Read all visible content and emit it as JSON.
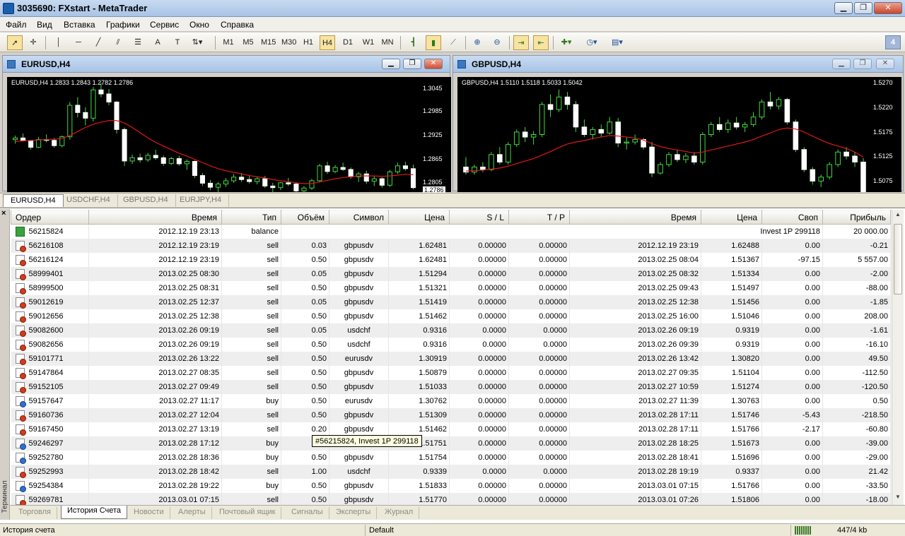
{
  "app": {
    "title": "3035690: FXstart - MetaTrader"
  },
  "window_buttons": {
    "minimize": "▁",
    "restore": "❐",
    "close": "✕"
  },
  "menu": [
    "Файл",
    "Вид",
    "Вставка",
    "Графики",
    "Сервис",
    "Окно",
    "Справка"
  ],
  "toolbar": {
    "tool_icons": [
      "cursor-icon",
      "crosshair-icon",
      "vertical-line-icon",
      "horizontal-line-icon",
      "trendline-icon",
      "equidistant-channel-icon",
      "fibonacci-icon",
      "text-icon",
      "text-label-icon",
      "arrows-icon"
    ],
    "timeframes": [
      "M1",
      "M5",
      "M15",
      "M30",
      "H1",
      "H4",
      "D1",
      "W1",
      "MN"
    ],
    "selected_timeframe": "H4",
    "pane_number": "4"
  },
  "charts": [
    {
      "title": "EURUSD,H4",
      "header": "EURUSD,H4  1.2833 1.2843 1.2782 1.2786",
      "prices": [
        "1.3045",
        "1.2985",
        "1.2925",
        "1.2865",
        "1.2805",
        "1.2786"
      ],
      "candles": [
        [
          1.2905,
          1.2915,
          1.2895,
          1.2909
        ],
        [
          1.2909,
          1.292,
          1.29,
          1.2902
        ],
        [
          1.2902,
          1.2904,
          1.288,
          1.2886
        ],
        [
          1.2886,
          1.2912,
          1.2884,
          1.2905
        ],
        [
          1.2905,
          1.2918,
          1.2898,
          1.2903
        ],
        [
          1.2903,
          1.2909,
          1.2885,
          1.289
        ],
        [
          1.289,
          1.2915,
          1.2886,
          1.2912
        ],
        [
          1.2912,
          1.2998,
          1.2905,
          1.299
        ],
        [
          1.299,
          1.301,
          1.296,
          1.2972
        ],
        [
          1.2972,
          1.2985,
          1.294,
          1.2958
        ],
        [
          1.2958,
          1.3035,
          1.295,
          1.3028
        ],
        [
          1.3028,
          1.3045,
          1.301,
          1.3018
        ],
        [
          1.3018,
          1.303,
          1.299,
          1.2998
        ],
        [
          1.2998,
          1.3,
          1.292,
          1.293
        ],
        [
          1.293,
          1.2935,
          1.284,
          1.2852
        ],
        [
          1.2852,
          1.2868,
          1.2845,
          1.286
        ],
        [
          1.286,
          1.287,
          1.2848,
          1.2855
        ],
        [
          1.2855,
          1.2872,
          1.285,
          1.2866
        ],
        [
          1.2866,
          1.288,
          1.2855,
          1.286
        ],
        [
          1.286,
          1.2866,
          1.284,
          1.2846
        ],
        [
          1.2846,
          1.2862,
          1.2842,
          1.2858
        ],
        [
          1.2858,
          1.2865,
          1.284,
          1.2845
        ],
        [
          1.2845,
          1.2856,
          1.283,
          1.2851
        ],
        [
          1.2851,
          1.2853,
          1.281,
          1.2816
        ],
        [
          1.2816,
          1.2822,
          1.279,
          1.2797
        ],
        [
          1.2797,
          1.2805,
          1.278,
          1.2787
        ],
        [
          1.2787,
          1.28,
          1.2775,
          1.2795
        ],
        [
          1.2795,
          1.281,
          1.2788,
          1.2803
        ],
        [
          1.2803,
          1.282,
          1.2798,
          1.2812
        ],
        [
          1.2812,
          1.2822,
          1.28,
          1.2806
        ],
        [
          1.2806,
          1.2816,
          1.2796,
          1.2801
        ],
        [
          1.2801,
          1.2812,
          1.2794,
          1.2808
        ],
        [
          1.2808,
          1.2815,
          1.2785,
          1.279
        ],
        [
          1.279,
          1.2798,
          1.2775,
          1.2786
        ],
        [
          1.2786,
          1.28,
          1.278,
          1.2798
        ],
        [
          1.2798,
          1.281,
          1.279,
          1.2795
        ],
        [
          1.2795,
          1.28,
          1.277,
          1.2778
        ],
        [
          1.2778,
          1.279,
          1.2765,
          1.2785
        ],
        [
          1.2785,
          1.2808,
          1.278,
          1.2803
        ],
        [
          1.2803,
          1.2845,
          1.28,
          1.284
        ],
        [
          1.284,
          1.285,
          1.282,
          1.2826
        ],
        [
          1.2826,
          1.2842,
          1.2822,
          1.2836
        ],
        [
          1.2836,
          1.2848,
          1.2828,
          1.2831
        ],
        [
          1.2831,
          1.2836,
          1.2808,
          1.2813
        ],
        [
          1.2813,
          1.2825,
          1.28,
          1.282
        ],
        [
          1.282,
          1.2828,
          1.2795,
          1.2802
        ],
        [
          1.2802,
          1.2815,
          1.279,
          1.2808
        ],
        [
          1.2808,
          1.2812,
          1.2786,
          1.2792
        ],
        [
          1.2792,
          1.283,
          1.2788,
          1.2825
        ],
        [
          1.2825,
          1.2848,
          1.282,
          1.284
        ],
        [
          1.284,
          1.285,
          1.2828,
          1.2833
        ],
        [
          1.2833,
          1.2843,
          1.2782,
          1.2786
        ]
      ],
      "ma": [
        1.29,
        1.2902,
        1.2903,
        1.2904,
        1.2905,
        1.2906,
        1.2908,
        1.2915,
        1.2925,
        1.2935,
        1.2943,
        1.2948,
        1.2952,
        1.2952,
        1.2946,
        1.2935,
        1.2922,
        1.2909,
        1.2898,
        1.2889,
        1.288,
        1.2871,
        1.2864,
        1.2856,
        1.2848,
        1.284,
        1.2833,
        1.2828,
        1.2824,
        1.282,
        1.2816,
        1.2813,
        1.281,
        1.2806,
        1.2803,
        1.2801,
        1.2798,
        1.2796,
        1.2796,
        1.28,
        1.2804,
        1.2808,
        1.2811,
        1.2813,
        1.2815,
        1.2815,
        1.2815,
        1.2814,
        1.2815,
        1.2817,
        1.2819,
        1.2818
      ],
      "range": [
        1.2775,
        1.306
      ]
    },
    {
      "title": "GBPUSD,H4",
      "header": "GBPUSD,H4  1.5110 1.5118 1.5033 1.5042",
      "prices": [
        "1.5270",
        "1.5220",
        "1.5175",
        "1.5125",
        "1.5075"
      ],
      "candles": [
        [
          1.51,
          1.512,
          1.5085,
          1.509
        ],
        [
          1.509,
          1.5105,
          1.5085,
          1.51
        ],
        [
          1.51,
          1.511,
          1.509,
          1.5095
        ],
        [
          1.5095,
          1.513,
          1.5092,
          1.5125
        ],
        [
          1.5125,
          1.514,
          1.5105,
          1.511
        ],
        [
          1.511,
          1.515,
          1.5105,
          1.5145
        ],
        [
          1.5145,
          1.5175,
          1.514,
          1.517
        ],
        [
          1.517,
          1.518,
          1.515,
          1.516
        ],
        [
          1.516,
          1.5172,
          1.5145,
          1.5165
        ],
        [
          1.5165,
          1.523,
          1.516,
          1.5225
        ],
        [
          1.5225,
          1.5245,
          1.52,
          1.5215
        ],
        [
          1.5215,
          1.5255,
          1.521,
          1.524
        ],
        [
          1.524,
          1.525,
          1.5215,
          1.5225
        ],
        [
          1.5225,
          1.5232,
          1.517,
          1.518
        ],
        [
          1.518,
          1.5195,
          1.516,
          1.5165
        ],
        [
          1.5165,
          1.518,
          1.5155,
          1.5175
        ],
        [
          1.5175,
          1.5185,
          1.516,
          1.5168
        ],
        [
          1.5168,
          1.52,
          1.5165,
          1.519
        ],
        [
          1.519,
          1.5198,
          1.514,
          1.5148
        ],
        [
          1.5148,
          1.516,
          1.5135,
          1.515
        ],
        [
          1.515,
          1.5165,
          1.5145,
          1.5155
        ],
        [
          1.5155,
          1.5158,
          1.5135,
          1.514
        ],
        [
          1.514,
          1.515,
          1.508,
          1.5088
        ],
        [
          1.5088,
          1.511,
          1.5085,
          1.5105
        ],
        [
          1.5105,
          1.513,
          1.51,
          1.5125
        ],
        [
          1.5125,
          1.5135,
          1.511,
          1.5115
        ],
        [
          1.5115,
          1.5128,
          1.5108,
          1.5122
        ],
        [
          1.5122,
          1.513,
          1.5105,
          1.511
        ],
        [
          1.511,
          1.517,
          1.5105,
          1.5165
        ],
        [
          1.5165,
          1.519,
          1.516,
          1.5185
        ],
        [
          1.5185,
          1.52,
          1.517,
          1.5175
        ],
        [
          1.5175,
          1.5195,
          1.5168,
          1.5188
        ],
        [
          1.5188,
          1.52,
          1.5175,
          1.518
        ],
        [
          1.518,
          1.519,
          1.517,
          1.5185
        ],
        [
          1.5185,
          1.521,
          1.518,
          1.52
        ],
        [
          1.52,
          1.5235,
          1.5195,
          1.523
        ],
        [
          1.523,
          1.525,
          1.5215,
          1.5222
        ],
        [
          1.5222,
          1.524,
          1.5215,
          1.5235
        ],
        [
          1.5235,
          1.5238,
          1.5185,
          1.519
        ],
        [
          1.519,
          1.5195,
          1.513,
          1.5135
        ],
        [
          1.5135,
          1.514,
          1.509,
          1.5095
        ],
        [
          1.5095,
          1.51,
          1.5065,
          1.5072
        ],
        [
          1.5072,
          1.5085,
          1.506,
          1.508
        ],
        [
          1.508,
          1.511,
          1.5075,
          1.5105
        ],
        [
          1.5105,
          1.5135,
          1.51,
          1.513
        ],
        [
          1.513,
          1.514,
          1.5115,
          1.5122
        ],
        [
          1.5122,
          1.513,
          1.51,
          1.511
        ],
        [
          1.511,
          1.5118,
          1.5033,
          1.5042
        ]
      ],
      "ma": [
        1.5092,
        1.5093,
        1.5094,
        1.5096,
        1.5098,
        1.5102,
        1.5107,
        1.5112,
        1.5117,
        1.5124,
        1.5131,
        1.5139,
        1.5146,
        1.515,
        1.5153,
        1.5157,
        1.516,
        1.5163,
        1.5162,
        1.516,
        1.5158,
        1.5154,
        1.5147,
        1.5141,
        1.5137,
        1.5134,
        1.5131,
        1.5128,
        1.513,
        1.5134,
        1.5138,
        1.5142,
        1.5146,
        1.515,
        1.5155,
        1.5162,
        1.5168,
        1.5175,
        1.5178,
        1.5176,
        1.517,
        1.5162,
        1.5154,
        1.5147,
        1.5142,
        1.5137,
        1.513,
        1.512
      ],
      "range": [
        1.505,
        1.528
      ]
    }
  ],
  "chart_tabs": [
    "EURUSD,H4",
    "USDCHF,H4",
    "GBPUSD,H4",
    "EURJPY,H4"
  ],
  "terminal": {
    "close": "×",
    "side_label": "Терминал",
    "columns": [
      "Ордер",
      "Время",
      "Тип",
      "Объём",
      "Символ",
      "Цена",
      "S / L",
      "T / P",
      "Время",
      "Цена",
      "Своп",
      "Прибыль"
    ],
    "rows": [
      [
        "bal",
        "56215824",
        "2012.12.19 23:13",
        "balance",
        "",
        "",
        "",
        "",
        "",
        "",
        "",
        "Invest 1P 299118",
        "20 000.00"
      ],
      [
        "sell",
        "56216108",
        "2012.12.19 23:19",
        "sell",
        "0.03",
        "gbpusdv",
        "1.62481",
        "0.00000",
        "0.00000",
        "2012.12.19 23:19",
        "1.62488",
        "0.00",
        "-0.21"
      ],
      [
        "sell",
        "56216124",
        "2012.12.19 23:19",
        "sell",
        "0.50",
        "gbpusdv",
        "1.62481",
        "0.00000",
        "0.00000",
        "2013.02.25 08:04",
        "1.51367",
        "-97.15",
        "5 557.00"
      ],
      [
        "sell",
        "58999401",
        "2013.02.25 08:30",
        "sell",
        "0.05",
        "gbpusdv",
        "1.51294",
        "0.00000",
        "0.00000",
        "2013.02.25 08:32",
        "1.51334",
        "0.00",
        "-2.00"
      ],
      [
        "sell",
        "58999500",
        "2013.02.25 08:31",
        "sell",
        "0.50",
        "gbpusdv",
        "1.51321",
        "0.00000",
        "0.00000",
        "2013.02.25 09:43",
        "1.51497",
        "0.00",
        "-88.00"
      ],
      [
        "sell",
        "59012619",
        "2013.02.25 12:37",
        "sell",
        "0.05",
        "gbpusdv",
        "1.51419",
        "0.00000",
        "0.00000",
        "2013.02.25 12:38",
        "1.51456",
        "0.00",
        "-1.85"
      ],
      [
        "sell",
        "59012656",
        "2013.02.25 12:38",
        "sell",
        "0.50",
        "gbpusdv",
        "1.51462",
        "0.00000",
        "0.00000",
        "2013.02.25 16:00",
        "1.51046",
        "0.00",
        "208.00"
      ],
      [
        "sell",
        "59082600",
        "2013.02.26 09:19",
        "sell",
        "0.05",
        "usdchf",
        "0.9316",
        "0.0000",
        "0.0000",
        "2013.02.26 09:19",
        "0.9319",
        "0.00",
        "-1.61"
      ],
      [
        "sell",
        "59082656",
        "2013.02.26 09:19",
        "sell",
        "0.50",
        "usdchf",
        "0.9316",
        "0.0000",
        "0.0000",
        "2013.02.26 09:39",
        "0.9319",
        "0.00",
        "-16.10"
      ],
      [
        "sell",
        "59101771",
        "2013.02.26 13:22",
        "sell",
        "0.50",
        "eurusdv",
        "1.30919",
        "0.00000",
        "0.00000",
        "2013.02.26 13:42",
        "1.30820",
        "0.00",
        "49.50"
      ],
      [
        "sell",
        "59147864",
        "2013.02.27 08:35",
        "sell",
        "0.50",
        "gbpusdv",
        "1.50879",
        "0.00000",
        "0.00000",
        "2013.02.27 09:35",
        "1.51104",
        "0.00",
        "-112.50"
      ],
      [
        "sell",
        "59152105",
        "2013.02.27 09:49",
        "sell",
        "0.50",
        "gbpusdv",
        "1.51033",
        "0.00000",
        "0.00000",
        "2013.02.27 10:59",
        "1.51274",
        "0.00",
        "-120.50"
      ],
      [
        "buy",
        "59157647",
        "2013.02.27 11:17",
        "buy",
        "0.50",
        "eurusdv",
        "1.30762",
        "0.00000",
        "0.00000",
        "2013.02.27 11:39",
        "1.30763",
        "0.00",
        "0.50"
      ],
      [
        "sell",
        "59160736",
        "2013.02.27 12:04",
        "sell",
        "0.50",
        "gbpusdv",
        "1.51309",
        "0.00000",
        "0.00000",
        "2013.02.28 17:11",
        "1.51746",
        "-5.43",
        "-218.50"
      ],
      [
        "sell",
        "59167450",
        "2013.02.27 13:19",
        "sell",
        "0.20",
        "gbpusdv",
        "1.51462",
        "0.00000",
        "0.00000",
        "2013.02.28 17:11",
        "1.51766",
        "-2.17",
        "-60.80"
      ],
      [
        "buy",
        "59246297",
        "2013.02.28 17:12",
        "buy",
        "",
        "",
        "1.51751",
        "0.00000",
        "0.00000",
        "2013.02.28 18:25",
        "1.51673",
        "0.00",
        "-39.00"
      ],
      [
        "buy",
        "59252780",
        "2013.02.28 18:36",
        "buy",
        "0.50",
        "gbpusdv",
        "1.51754",
        "0.00000",
        "0.00000",
        "2013.02.28 18:41",
        "1.51696",
        "0.00",
        "-29.00"
      ],
      [
        "sell",
        "59252993",
        "2013.02.28 18:42",
        "sell",
        "1.00",
        "usdchf",
        "0.9339",
        "0.0000",
        "0.0000",
        "2013.02.28 19:19",
        "0.9337",
        "0.00",
        "21.42"
      ],
      [
        "buy",
        "59254384",
        "2013.02.28 19:22",
        "buy",
        "0.50",
        "gbpusdv",
        "1.51833",
        "0.00000",
        "0.00000",
        "2013.03.01 07:15",
        "1.51766",
        "0.00",
        "-33.50"
      ],
      [
        "sell",
        "59269781",
        "2013.03.01 07:15",
        "sell",
        "0.50",
        "gbpusdv",
        "1.51770",
        "0.00000",
        "0.00000",
        "2013.03.01 07:26",
        "1.51806",
        "0.00",
        "-18.00"
      ]
    ],
    "tooltip": "#56215824, Invest 1P 299118",
    "tabs": [
      "Торговля",
      "История Счета",
      "Новости",
      "Алерты",
      "Почтовый ящик",
      "Сигналы",
      "Эксперты",
      "Журнал"
    ],
    "active_tab": "История Счета"
  },
  "status": {
    "left": "История счета",
    "profile": "Default",
    "traffic": "447/4 kb"
  }
}
